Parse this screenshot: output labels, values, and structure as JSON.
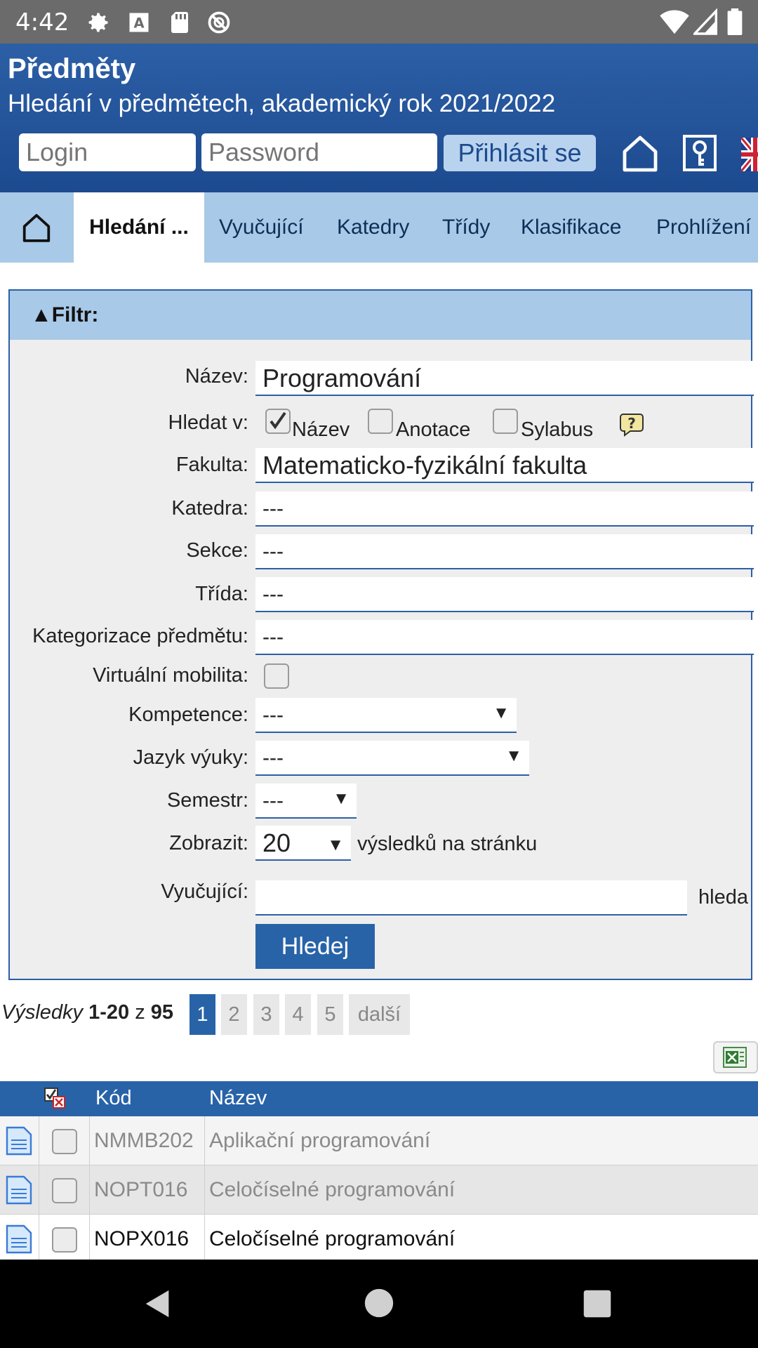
{
  "status_bar": {
    "time": "4:42",
    "icons": [
      "gear-icon",
      "font-icon",
      "sd-card-icon",
      "no-sync-icon",
      "wifi-icon",
      "signal-icon",
      "battery-icon"
    ]
  },
  "header": {
    "title": "Předměty",
    "subtitle": "Hledání v předmětech, akademický rok 2021/2022",
    "login_placeholder": "Login",
    "password_placeholder": "Password",
    "login_button": "Přihlásit se"
  },
  "nav": {
    "tabs": [
      {
        "label": "Hledání ..."
      },
      {
        "label": "Vyučující"
      },
      {
        "label": "Katedry"
      },
      {
        "label": "Třídy"
      },
      {
        "label": "Klasifikace"
      },
      {
        "label": "Prohlížení"
      }
    ]
  },
  "filter": {
    "heading": "▲Filtr:",
    "nazev": {
      "label": "Název:",
      "value": "Programování"
    },
    "hledat_v": {
      "label": "Hledat v:",
      "options": [
        {
          "label": "Název",
          "checked": true
        },
        {
          "label": "Anotace",
          "checked": false
        },
        {
          "label": "Sylabus",
          "checked": false
        }
      ]
    },
    "fakulta": {
      "label": "Fakulta:",
      "value": "Matematicko-fyzikální fakulta"
    },
    "katedra": {
      "label": "Katedra:",
      "value": "---"
    },
    "sekce": {
      "label": "Sekce:",
      "value": "---"
    },
    "trida": {
      "label": "Třída:",
      "value": "---"
    },
    "kategorizace": {
      "label": "Kategorizace předmětu:",
      "value": "---"
    },
    "virtualni": {
      "label": "Virtuální mobilita:",
      "checked": false
    },
    "kompetence": {
      "label": "Kompetence:",
      "value": "---"
    },
    "jazyk": {
      "label": "Jazyk výuky:",
      "value": "---"
    },
    "semestr": {
      "label": "Semestr:",
      "value": "---"
    },
    "zobrazit": {
      "label": "Zobrazit:",
      "value": "20",
      "suffix": "výsledků na stránku"
    },
    "vyucujici": {
      "label": "Vyučující:",
      "value": "",
      "suffix": "hleda"
    },
    "search_button": "Hledej"
  },
  "results": {
    "prefix": "Výsledky",
    "range": "1-20",
    "of": "z",
    "total": "95",
    "pages": [
      "1",
      "2",
      "3",
      "4",
      "5",
      "další"
    ],
    "current_page": "1"
  },
  "table": {
    "headers": {
      "kod": "Kód",
      "nazev": "Název"
    },
    "rows": [
      {
        "kod": "NMMB202",
        "nazev": "Aplikační programování",
        "muted": true
      },
      {
        "kod": "NOPT016",
        "nazev": "Celočíselné programování",
        "muted": true
      },
      {
        "kod": "NOPX016",
        "nazev": "Celočíselné programování",
        "muted": false
      }
    ]
  },
  "colors": {
    "header_blue": "#2c5fa6",
    "nav_light_blue": "#a8c9e8",
    "button_blue": "#2863a8"
  }
}
